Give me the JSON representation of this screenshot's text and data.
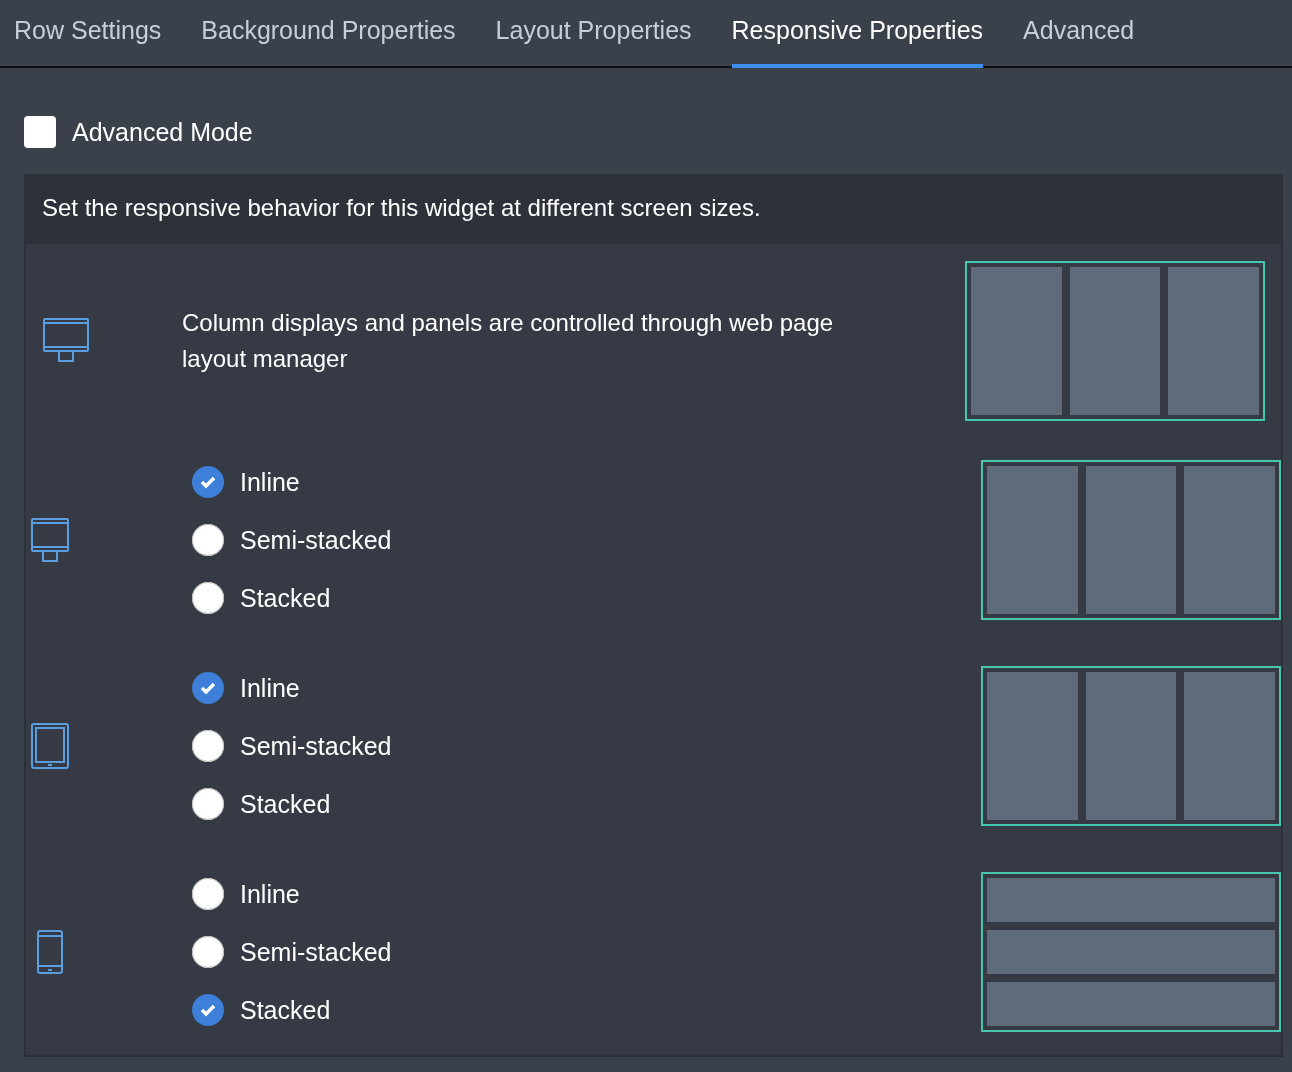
{
  "tabs": [
    {
      "label": "Row Settings",
      "selected": false
    },
    {
      "label": "Background Properties",
      "selected": false
    },
    {
      "label": "Layout Properties",
      "selected": false
    },
    {
      "label": "Responsive Properties",
      "selected": true
    },
    {
      "label": "Advanced",
      "selected": false
    }
  ],
  "advanced_mode": {
    "label": "Advanced Mode",
    "checked": false
  },
  "description": "Set the responsive behavior for this widget at different screen sizes.",
  "devices": [
    {
      "kind": "desktop",
      "note": "Column displays and panels are controlled through web page layout manager"
    },
    {
      "kind": "laptop",
      "options": [
        {
          "label": "Inline",
          "selected": true
        },
        {
          "label": "Semi-stacked",
          "selected": false
        },
        {
          "label": "Stacked",
          "selected": false
        }
      ]
    },
    {
      "kind": "tablet",
      "options": [
        {
          "label": "Inline",
          "selected": true
        },
        {
          "label": "Semi-stacked",
          "selected": false
        },
        {
          "label": "Stacked",
          "selected": false
        }
      ]
    },
    {
      "kind": "phone",
      "options": [
        {
          "label": "Inline",
          "selected": false
        },
        {
          "label": "Semi-stacked",
          "selected": false
        },
        {
          "label": "Stacked",
          "selected": true
        }
      ]
    }
  ]
}
